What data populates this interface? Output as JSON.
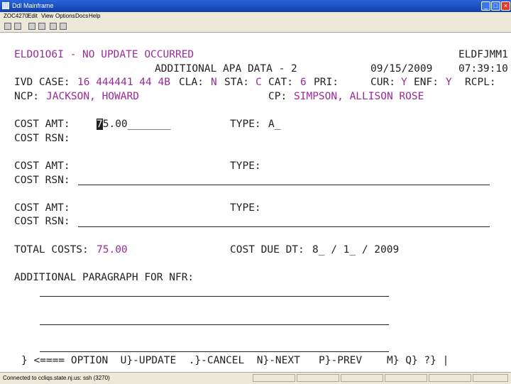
{
  "window": {
    "title": "Ddl Mainframe"
  },
  "menu": [
    "ZOC4270",
    "Edit",
    "View",
    "Options",
    "Docs",
    "Help"
  ],
  "screen": {
    "header_line1_left": "ELDO1O6I - NO UPDATE OCCURRED",
    "header_line1_right": "ELDFJMM1",
    "header_title": "ADDITIONAL APA DATA - 2",
    "header_date": "09/15/2009",
    "header_time": "07:39:10",
    "ivd_case_label": "IVD CASE:",
    "ivd_case_value": "16 444441 44 4B",
    "cla_label": "CLA:",
    "cla_value": "N",
    "sta_label": "STA:",
    "sta_value": "C",
    "cat_label": "CAT:",
    "cat_value": "6",
    "pri_label": "PRI:",
    "cur_label": "CUR:",
    "cur_value": "Y",
    "enf_label": "ENF:",
    "enf_value": "Y",
    "rcpl_label": "RCPL:",
    "ncp_label": "NCP:",
    "ncp_value": "JACKSON, HOWARD",
    "cp_label": "CP:",
    "cp_value": "SIMPSON, ALLISON ROSE",
    "cost_amt_label": "COST AMT:",
    "cost_rsn_label": "COST RSN:",
    "type_label": "TYPE:",
    "cost1_amt_first": "7",
    "cost1_amt_rest": "5.00_______",
    "cost1_type_value": "A_",
    "total_costs_label": "TOTAL COSTS:",
    "total_costs_value": "75.00",
    "cost_due_label": "COST DUE DT:",
    "cost_due_value": "8_ / 1_ / 2009",
    "additional_paragraph_label": "ADDITIONAL PARAGRAPH FOR NFR:",
    "footer_line": "} <==== OPTION  U}-UPDATE  .}-CANCEL  N}-NEXT   P}-PREV    M} Q} ?} |"
  },
  "status": {
    "text": "Connected to ccliqs.state.nj.us:  ssh (3270)"
  },
  "colors": {
    "magenta": "#9b2a9b",
    "text": "#222222",
    "titlebar": "#1f52c8"
  }
}
